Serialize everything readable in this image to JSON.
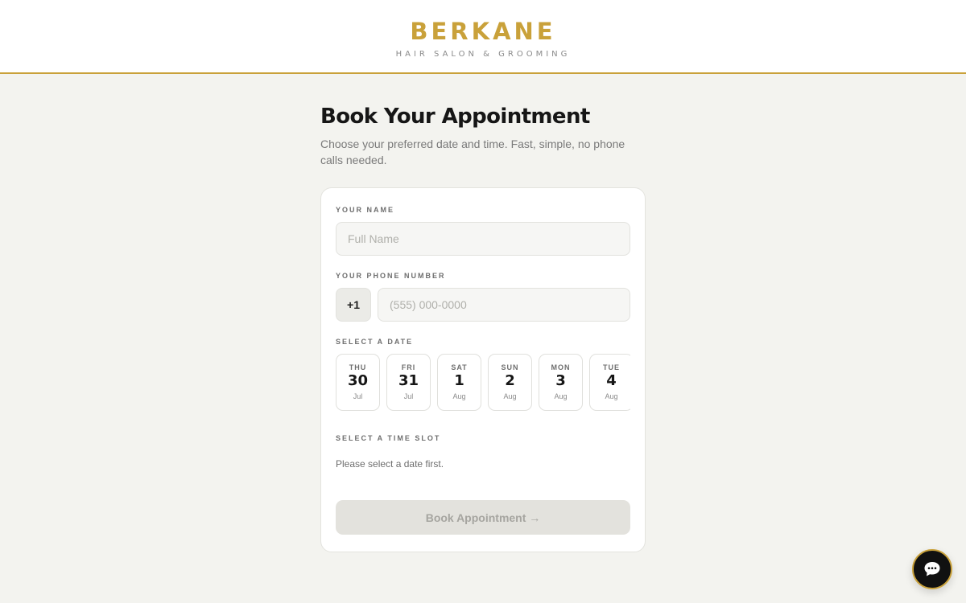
{
  "header": {
    "brand": "BERKANE",
    "tagline": "HAIR SALON & GROOMING"
  },
  "main": {
    "title": "Book Your Appointment",
    "subtitle": "Choose your preferred date and time. Fast, simple, no phone calls needed."
  },
  "form": {
    "name_label": "YOUR NAME",
    "name_placeholder": "Full Name",
    "name_value": "",
    "phone_label": "YOUR PHONE NUMBER",
    "country_code": "+1",
    "phone_placeholder": "(555) 000-0000",
    "phone_value": "",
    "date_label": "SELECT A DATE",
    "dates": [
      {
        "dow": "THU",
        "day": "30",
        "month": "Jul"
      },
      {
        "dow": "FRI",
        "day": "31",
        "month": "Jul"
      },
      {
        "dow": "SAT",
        "day": "1",
        "month": "Aug"
      },
      {
        "dow": "SUN",
        "day": "2",
        "month": "Aug"
      },
      {
        "dow": "MON",
        "day": "3",
        "month": "Aug"
      },
      {
        "dow": "TUE",
        "day": "4",
        "month": "Aug"
      }
    ],
    "time_label": "SELECT A TIME SLOT",
    "time_hint": "Please select a date first.",
    "submit_label": "Book Appointment →"
  },
  "chat": {
    "icon": "chat-bubble-icon"
  },
  "colors": {
    "accent": "#c9a13a",
    "background": "#f3f3ef",
    "disabled_button": "#e3e2dd"
  }
}
